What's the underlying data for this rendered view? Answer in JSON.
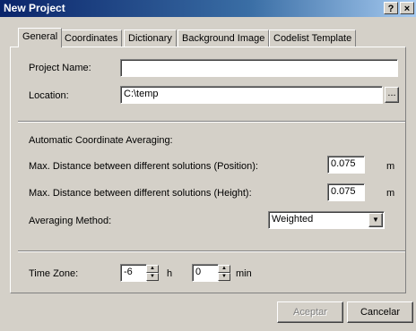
{
  "window": {
    "title": "New Project",
    "help_label": "?",
    "close_label": "×"
  },
  "tabs": [
    "General",
    "Coordinates",
    "Dictionary",
    "Background Image",
    "Codelist Template"
  ],
  "project": {
    "name_label": "Project Name:",
    "name_value": "",
    "location_label": "Location:",
    "location_value": "C:\\temp",
    "browse_label": "..."
  },
  "averaging": {
    "section_label": "Automatic Coordinate Averaging:",
    "position_label": "Max. Distance between different solutions (Position):",
    "position_value": "0.075",
    "position_unit": "m",
    "height_label": "Max. Distance between different solutions (Height):",
    "height_value": "0.075",
    "height_unit": "m",
    "method_label": "Averaging Method:",
    "method_value": "Weighted"
  },
  "timezone": {
    "label": "Time Zone:",
    "hours_value": "-6",
    "hours_unit": "h",
    "minutes_value": "0",
    "minutes_unit": "min"
  },
  "footer": {
    "accept_label": "Aceptar",
    "cancel_label": "Cancelar"
  }
}
